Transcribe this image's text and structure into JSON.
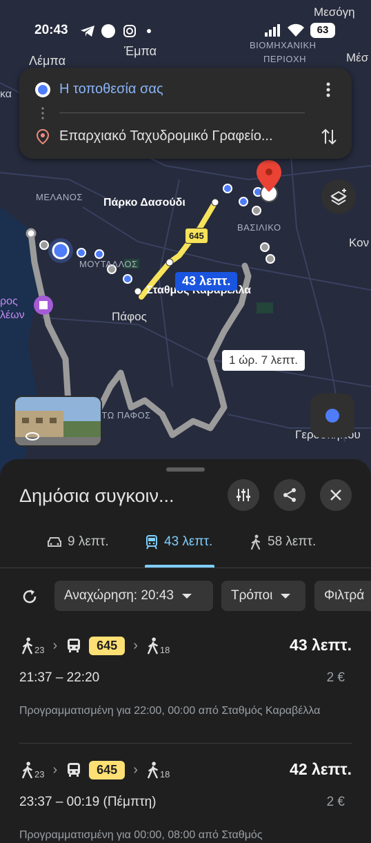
{
  "status_bar": {
    "time": "20:43",
    "battery": "63"
  },
  "map": {
    "labels": {
      "mesogi": "Μεσόγη",
      "empa": "Έμπα",
      "lempa": "Λέμπα",
      "industrial_1": "ΒΙΟΜΗΧΑΝΙΚΗ",
      "industrial_2": "ΠΕΡΙΟΧΗ",
      "meso": "Μέσ",
      "ka": "κα",
      "melanos": "ΜΕΛΑΝΟΣ",
      "parko": "Πάρκο Δασούδι",
      "vasiliko": "ΒΑΣΙΛΙΚΟ",
      "kon": "Κον",
      "moutallos": "ΜΟΥΤΑΛΛΟΣ",
      "stathmos": "Σταθμός Καραβέλλα",
      "pafos": "Πάφος",
      "kato_pafos": "ΚΑΤΩ ΠΑΦΟΣ",
      "ros": "ρος",
      "leon": "λέων",
      "geroskipou": "Γεροσκήπου"
    },
    "bus_route_badge": "645",
    "transit_duration_badge": "43 λεπτ.",
    "alt_duration_badge": "1 ώρ. 7 λεπτ."
  },
  "search": {
    "origin": "Η τοποθεσία σας",
    "destination": "Επαρχιακό Ταχυδρομικό Γραφείο..."
  },
  "sheet": {
    "title": "Δημόσια συγκοιν...",
    "modes": [
      {
        "label": "9 λεπτ.",
        "icon": "car-icon"
      },
      {
        "label": "43 λεπτ.",
        "icon": "train-icon"
      },
      {
        "label": "58 λεπτ.",
        "icon": "walk-icon"
      }
    ],
    "chips": {
      "departure": "Αναχώρηση: 20:43",
      "modes": "Τρόποι",
      "filters": "Φιλτρά"
    },
    "routes": [
      {
        "walk_before": "23",
        "bus": "645",
        "walk_after": "18",
        "duration": "43 λεπτ.",
        "times": "21:37 – 22:20",
        "price": "2 €",
        "note": "Προγραμματισμένη για 22:00, 00:00 από Σταθμός Καραβέλλα"
      },
      {
        "walk_before": "23",
        "bus": "645",
        "walk_after": "18",
        "duration": "42 λεπτ.",
        "times": "23:37 – 00:19 (Πέμπτη)",
        "price": "2 €",
        "note": "Προγραμματισμένη για 00:00, 08:00 από Σταθμός"
      }
    ]
  },
  "colors": {
    "accent": "#7fcfff",
    "bus_badge": "#fde073",
    "route_blue": "#4f7df9",
    "route_yellow": "#f6e35a"
  }
}
